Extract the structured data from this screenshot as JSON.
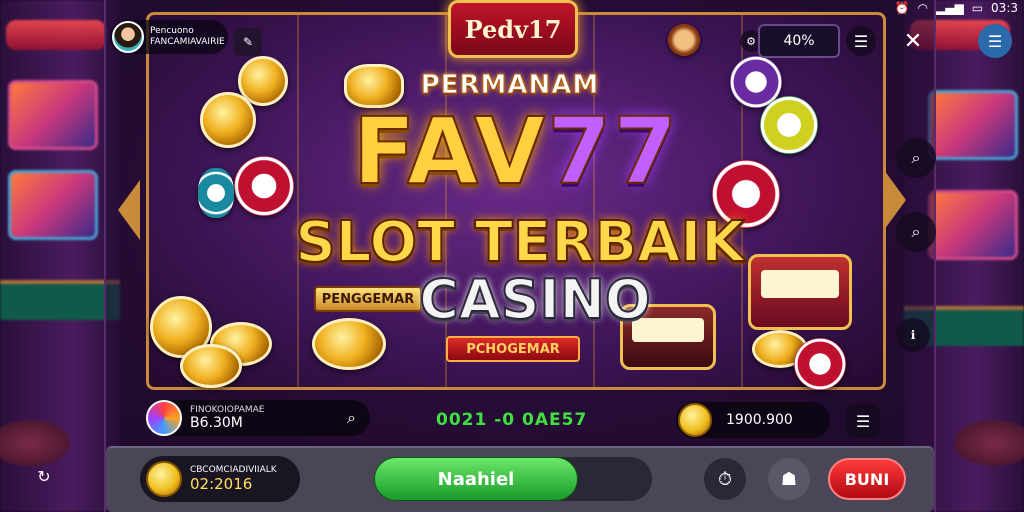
{
  "status_bar": {
    "time": "03:3",
    "battery": "▭"
  },
  "profile": {
    "name_line1": "Pencuono",
    "name_line2": "FANCAMIAVAIRIE"
  },
  "logo_text": "Pedv17",
  "percent": "40%",
  "titles": {
    "line1": "PERMANAM",
    "line2_a": "FAV",
    "line2_b": "77",
    "line3": "SLOT TERBAIK",
    "line4": "CASINO",
    "ribbon_left": "PENGGEMAR",
    "ribbon_bottom": "PCHOGEMAR"
  },
  "info": {
    "game_label": "FINOKOIOPAMAE",
    "game_value": "B6.30M",
    "center_value": "0021 -0 0AE57",
    "balance_value": "1900.900"
  },
  "bottom": {
    "coin_label": "CBCOMCIADIVIIALK",
    "coin_value": "02:2016",
    "spin_label": "Naahiel",
    "buy_label": "BUNI"
  },
  "colors": {
    "accent_gold": "#ffd040",
    "accent_purple": "#c060ff",
    "spin_green": "#1a9a2a",
    "buy_red": "#e02a2a"
  }
}
